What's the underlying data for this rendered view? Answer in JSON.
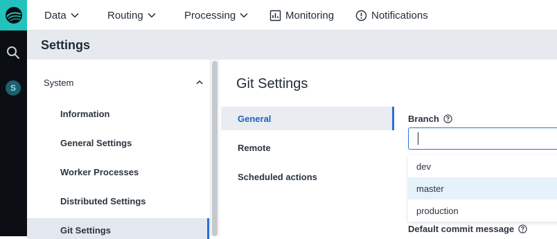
{
  "nav": {
    "items": [
      {
        "label": "Data",
        "has_chevron": true
      },
      {
        "label": "Routing",
        "has_chevron": true
      },
      {
        "label": "Processing",
        "has_chevron": true
      },
      {
        "label": "Monitoring",
        "icon": "chart-icon"
      },
      {
        "label": "Notifications",
        "icon": "alert-icon"
      }
    ]
  },
  "rail": {
    "avatar_letter": "S"
  },
  "header": {
    "title": "Settings"
  },
  "sidebar": {
    "section": "System",
    "items": [
      {
        "label": "Information"
      },
      {
        "label": "General Settings"
      },
      {
        "label": "Worker Processes"
      },
      {
        "label": "Distributed Settings"
      },
      {
        "label": "Git Settings"
      }
    ],
    "active_item": "Git Settings"
  },
  "main": {
    "title": "Git Settings",
    "tabs": [
      {
        "label": "General"
      },
      {
        "label": "Remote"
      },
      {
        "label": "Scheduled actions"
      }
    ],
    "active_tab": "General"
  },
  "form": {
    "branch_label": "Branch",
    "branch_value": "",
    "branch_options": [
      "dev",
      "master",
      "production"
    ],
    "highlighted_option": "master",
    "commit_label": "Default commit message"
  },
  "colors": {
    "accent": "#2c6fd6",
    "brand": "#22c3bd",
    "rail": "#0b0f14"
  }
}
